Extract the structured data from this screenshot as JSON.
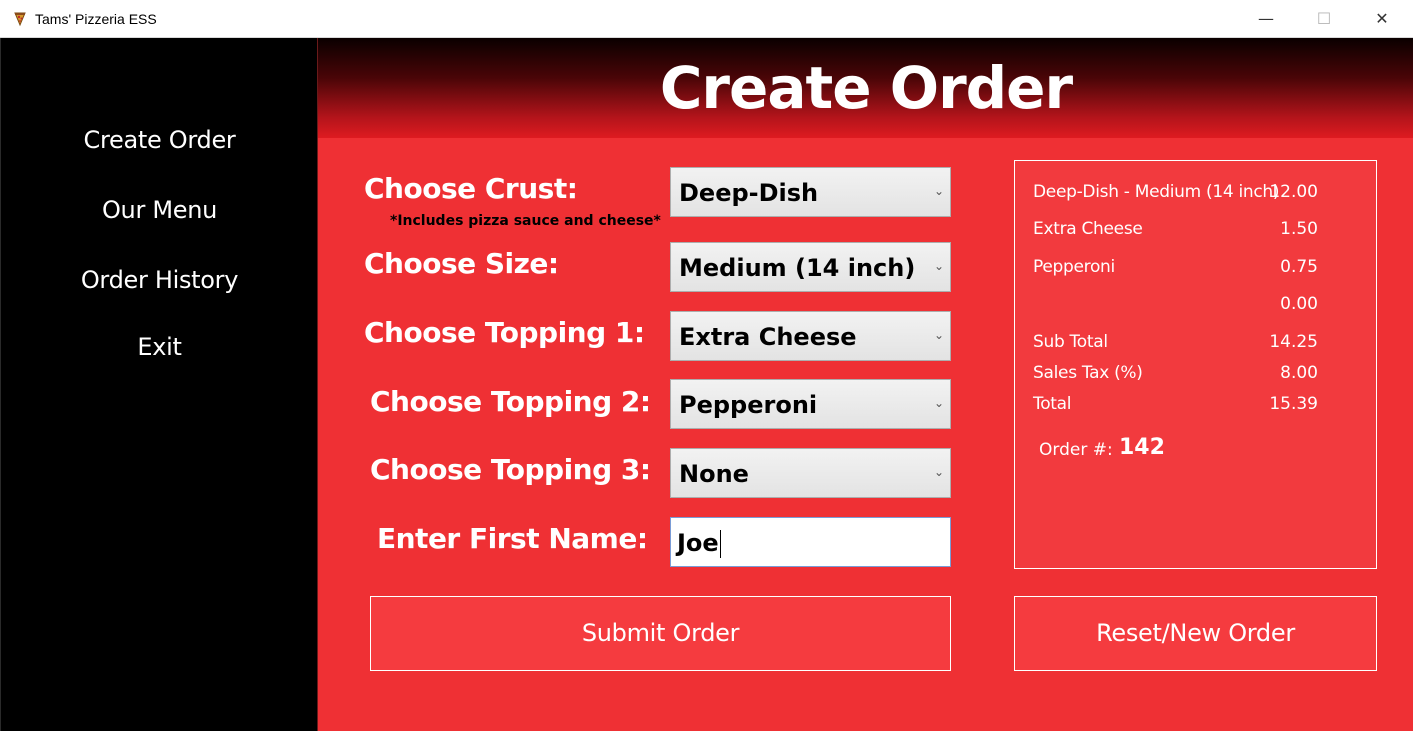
{
  "window": {
    "title": "Tams' Pizzeria ESS",
    "controls": {
      "minimize": "—",
      "maximize": "☐",
      "close": "✕"
    }
  },
  "sidebar": {
    "items": [
      {
        "label": "Create Order"
      },
      {
        "label": "Our Menu"
      },
      {
        "label": "Order History"
      },
      {
        "label": "Exit"
      }
    ]
  },
  "header": {
    "title": "Create Order"
  },
  "form": {
    "crust": {
      "label": "Choose Crust:",
      "note": "*Includes pizza sauce and cheese*",
      "value": "Deep-Dish"
    },
    "size": {
      "label": "Choose Size:",
      "value": "Medium (14 inch)"
    },
    "topping1": {
      "label": "Choose Topping 1:",
      "value": "Extra Cheese"
    },
    "topping2": {
      "label": "Choose Topping 2:",
      "value": "Pepperoni"
    },
    "topping3": {
      "label": "Choose Topping 3:",
      "value": "None"
    },
    "first_name": {
      "label": "Enter First Name:",
      "value": "Joe"
    },
    "chevron": "⌄"
  },
  "summary": {
    "lines": [
      {
        "name": "Deep-Dish - Medium (14 inch)",
        "price": "12.00"
      },
      {
        "name": "Extra Cheese",
        "price": "1.50"
      },
      {
        "name": "Pepperoni",
        "price": "0.75"
      },
      {
        "name": "",
        "price": "0.00"
      }
    ],
    "subtotal": {
      "label": "Sub Total",
      "value": "14.25"
    },
    "tax": {
      "label": "Sales Tax (%)",
      "value": "8.00"
    },
    "total": {
      "label": "Total",
      "value": "15.39"
    },
    "order": {
      "label": "Order #:",
      "number": "142"
    }
  },
  "buttons": {
    "submit": "Submit Order",
    "reset": "Reset/New Order"
  },
  "colors": {
    "sidebar_bg": "#000000",
    "main_bg": "#ef3034",
    "header_dark": "#0a0000",
    "header_red": "#de1b20",
    "text": "#ffffff"
  }
}
